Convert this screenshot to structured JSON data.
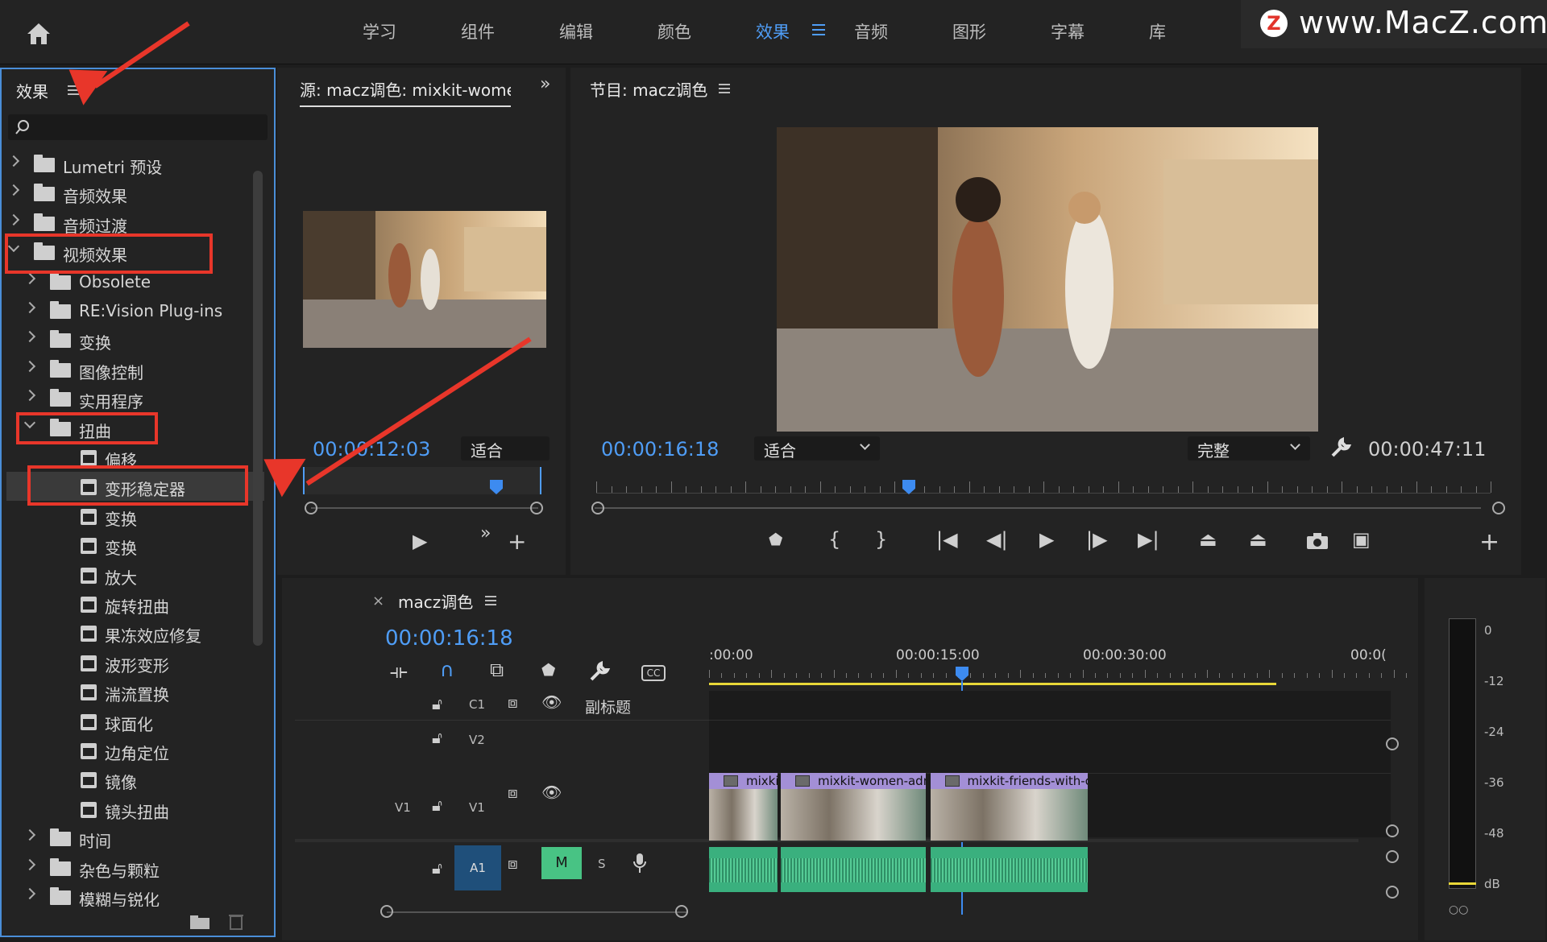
{
  "topnav": {
    "items": [
      {
        "label": "学习",
        "active": false
      },
      {
        "label": "组件",
        "active": false
      },
      {
        "label": "编辑",
        "active": false
      },
      {
        "label": "颜色",
        "active": false
      },
      {
        "label": "效果",
        "active": true
      },
      {
        "label": "音频",
        "active": false
      },
      {
        "label": "图形",
        "active": false
      },
      {
        "label": "字幕",
        "active": false
      },
      {
        "label": "库",
        "active": false
      }
    ]
  },
  "watermark": {
    "badge": "Z",
    "url": "www.MacZ.com"
  },
  "effects_panel": {
    "title": "效果",
    "search_placeholder": "",
    "tree": [
      {
        "label": "Lumetri 预设",
        "level": 0,
        "type": "folder",
        "state": "closed"
      },
      {
        "label": "音频效果",
        "level": 0,
        "type": "folder",
        "state": "closed"
      },
      {
        "label": "音频过渡",
        "level": 0,
        "type": "folder",
        "state": "closed"
      },
      {
        "label": "视频效果",
        "level": 0,
        "type": "folder",
        "state": "open"
      },
      {
        "label": "Obsolete",
        "level": 1,
        "type": "folder",
        "state": "closed"
      },
      {
        "label": "RE:Vision Plug-ins",
        "level": 1,
        "type": "folder",
        "state": "closed"
      },
      {
        "label": "变换",
        "level": 1,
        "type": "folder",
        "state": "closed"
      },
      {
        "label": "图像控制",
        "level": 1,
        "type": "folder",
        "state": "closed"
      },
      {
        "label": "实用程序",
        "level": 1,
        "type": "folder",
        "state": "closed"
      },
      {
        "label": "扭曲",
        "level": 1,
        "type": "folder",
        "state": "open"
      },
      {
        "label": "偏移",
        "level": 2,
        "type": "effect"
      },
      {
        "label": "变形稳定器",
        "level": 2,
        "type": "effect",
        "selected": true
      },
      {
        "label": "变换",
        "level": 2,
        "type": "effect"
      },
      {
        "label": "变换",
        "level": 2,
        "type": "effect"
      },
      {
        "label": "放大",
        "level": 2,
        "type": "effect"
      },
      {
        "label": "旋转扭曲",
        "level": 2,
        "type": "effect"
      },
      {
        "label": "果冻效应修复",
        "level": 2,
        "type": "effect"
      },
      {
        "label": "波形变形",
        "level": 2,
        "type": "effect"
      },
      {
        "label": "湍流置换",
        "level": 2,
        "type": "effect"
      },
      {
        "label": "球面化",
        "level": 2,
        "type": "effect"
      },
      {
        "label": "边角定位",
        "level": 2,
        "type": "effect"
      },
      {
        "label": "镜像",
        "level": 2,
        "type": "effect"
      },
      {
        "label": "镜头扭曲",
        "level": 2,
        "type": "effect"
      },
      {
        "label": "时间",
        "level": 1,
        "type": "folder",
        "state": "closed"
      },
      {
        "label": "杂色与颗粒",
        "level": 1,
        "type": "folder",
        "state": "closed"
      },
      {
        "label": "模糊与锐化",
        "level": 1,
        "type": "folder",
        "state": "closed"
      }
    ]
  },
  "source_panel": {
    "title": "源: macz调色: mixkit-womei",
    "timecode": "00:00:12:03",
    "fit": "适合"
  },
  "program_panel": {
    "title": "节目: macz调色",
    "timecode": "00:00:16:18",
    "fit": "适合",
    "quality": "完整",
    "duration": "00:00:47:11"
  },
  "timeline": {
    "sequence_name": "macz调色",
    "timecode": "00:00:16:18",
    "ruler_labels": [
      ":00:00",
      "00:00:15:00",
      "00:00:30:00",
      "00:0("
    ],
    "tracks": {
      "c1": {
        "name": "C1",
        "label": "副标题"
      },
      "v2": {
        "name": "V2"
      },
      "v1": {
        "name": "V1",
        "source": "V1"
      },
      "a1": {
        "name": "A1",
        "mute": "M",
        "solo": "S"
      }
    },
    "clips": [
      {
        "label": "mixkit-sm",
        "start_sec": 0,
        "end_sec": 4.5
      },
      {
        "label": "mixkit-women-admire-roma",
        "start_sec": 4.7,
        "end_sec": 14.2
      },
      {
        "label": "mixkit-friends-with-colored-sm",
        "start_sec": 14.5,
        "end_sec": 24.8
      }
    ]
  },
  "meter": {
    "labels": [
      "0",
      "-12",
      "-24",
      "-36",
      "-48",
      "dB"
    ]
  },
  "colors": {
    "accent": "#4f9df6",
    "annotation": "#e8362a",
    "clip_video": "#a38fd6",
    "clip_audio": "#3ab07e"
  }
}
